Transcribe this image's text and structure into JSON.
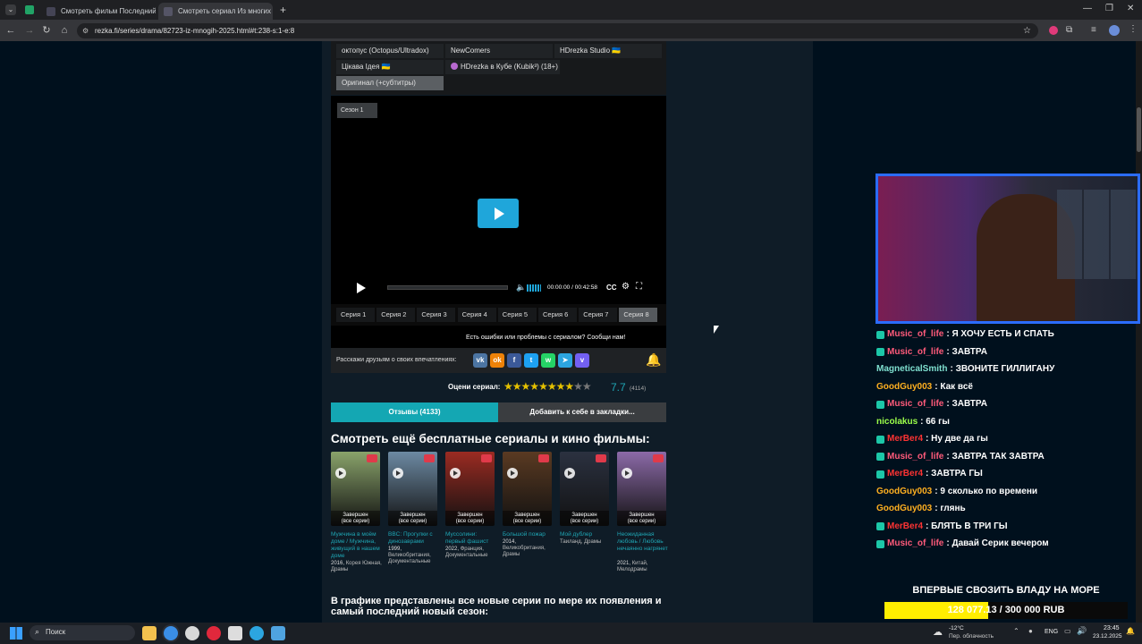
{
  "browser": {
    "tabs": [
      {
        "title": "Смотреть фильм Последний -"
      },
      {
        "title": "Смотреть сериал Из многих /"
      }
    ],
    "new_tab": "+",
    "url": "rezka.fi/series/drama/82723-iz-mnogih-2025.html#t:238-s:1-e:8"
  },
  "translators": [
    {
      "label": "октопус (Octopus/Ultradox)"
    },
    {
      "label": "NewComers"
    },
    {
      "label": "HDrezka Studio 🇺🇦"
    },
    {
      "label": "Цікава Ідея 🇺🇦"
    },
    {
      "label": "HDrezka в Кубе (Kubik³) (18+)"
    },
    {
      "label": "Оригинал (+субтитры)"
    }
  ],
  "player": {
    "season": "Сезон 1",
    "time": "00:00:00 / 00:42:58",
    "cc": "CC",
    "progress": 0
  },
  "episodes": [
    "Серия 1",
    "Серия 2",
    "Серия 3",
    "Серия 4",
    "Серия 5",
    "Серия 6",
    "Серия 7",
    "Серия 8"
  ],
  "selected_episode": "Серия 8",
  "error_report": "Есть ошибки или проблемы с сериалом? Сообщи нам!",
  "share_text": "Расскажи друзьям о своих впечатлениях:",
  "share_icons": [
    "vk-icon",
    "ok-icon",
    "facebook-icon",
    "twitter-icon",
    "whatsapp-icon",
    "telegram-icon",
    "viber-icon"
  ],
  "rating": {
    "label": "Оцени сериал:",
    "value": "7.7",
    "votes": "(4114)",
    "stars_filled": 8,
    "stars_total": 10
  },
  "tabs": {
    "reviews": "Отзывы (4133)",
    "bookmark": "Добавить к себе в закладки..."
  },
  "more_heading": "Смотреть ещё бесплатные сериалы и кино фильмы:",
  "posters": [
    {
      "status": "Завершен\n(все серии)",
      "title": "Мужчина в моём доме / Мужчина, живущий в нашем доме",
      "year": "2016,",
      "meta": "Корея Южная, Драмы",
      "color": "#8aa36b"
    },
    {
      "status": "Завершен\n(все серии)",
      "title": "BBC: Прогулки с динозаврами",
      "year": "1999,",
      "meta": "Великобритания, Документальные",
      "color": "#6d8aa3"
    },
    {
      "status": "Завершен\n(все серии)",
      "title": "Муссолини: первый фашист",
      "year": "2022,",
      "meta": "Франция, Документальные",
      "color": "#9b2b22"
    },
    {
      "status": "Завершен\n(все серии)",
      "title": "Большой пожар",
      "year": "2014,",
      "meta": "Великобритания, Драмы",
      "color": "#5a3a22"
    },
    {
      "status": "Завершен\n(все серии)",
      "title": "Мой дублер",
      "year": "",
      "meta": "Таиланд, Драмы",
      "color": "#2b3140"
    },
    {
      "status": "Завершен\n(все серии)",
      "title": "Неожиданная любовь / Любовь нечаянно нагрянет",
      "year": "2021,",
      "meta": "Китай, Мелодрамы",
      "color": "#8c6aa8"
    }
  ],
  "bottom_heading": "В графике представлены все новые серии по мере их появления и самый последний новый сезон:",
  "chat": [
    {
      "user": "Music_of_life",
      "color": "#ff5a7a",
      "msg": ": Я ХОЧУ ЕСТЬ И СПАТЬ",
      "badge": true
    },
    {
      "user": "Music_of_life",
      "color": "#ff5a7a",
      "msg": ": ЗАВТРА",
      "badge": true
    },
    {
      "user": "MagneticalSmith",
      "color": "#7fe0d0",
      "msg": ": ЗВОНИТЕ ГИЛЛИГАНУ",
      "badge": false
    },
    {
      "user": "GoodGuy003",
      "color": "#ffb020",
      "msg": ": Как всё",
      "badge": false
    },
    {
      "user": "Music_of_life",
      "color": "#ff5a7a",
      "msg": ": ЗАВТРА",
      "badge": true
    },
    {
      "user": "nicolakus",
      "color": "#9cff4a",
      "msg": ": 66 гы",
      "badge": false
    },
    {
      "user": "MerBer4",
      "color": "#ff3333",
      "msg": ": Ну две да гы",
      "badge": true
    },
    {
      "user": "Music_of_life",
      "color": "#ff5a7a",
      "msg": ": ЗАВТРА ТАК ЗАВТРА",
      "badge": true
    },
    {
      "user": "MerBer4",
      "color": "#ff3333",
      "msg": ": ЗАВТРА ГЫ",
      "badge": true
    },
    {
      "user": "GoodGuy003",
      "color": "#ffb020",
      "msg": ": 9 сколько по времени",
      "badge": false
    },
    {
      "user": "GoodGuy003",
      "color": "#ffb020",
      "msg": ": глянь",
      "badge": false
    },
    {
      "user": "MerBer4",
      "color": "#ff3333",
      "msg": ": БЛЯТЬ В ТРИ ГЫ",
      "badge": true
    },
    {
      "user": "Music_of_life",
      "color": "#ff5a7a",
      "msg": ": Давай Серик вечером",
      "badge": true
    }
  ],
  "donation": {
    "title": "ВПЕРВЫЕ СВОЗИТЬ ВЛАДУ НА МОРЕ",
    "text": "128 077.13 / 300 000 RUB",
    "fraction": 0.427
  },
  "taskbar": {
    "search": "Поиск",
    "weather_temp": "-12°C",
    "weather_desc": "Пер. облачность",
    "lang": "ENG",
    "time": "23:45",
    "date": "23.12.2025"
  }
}
